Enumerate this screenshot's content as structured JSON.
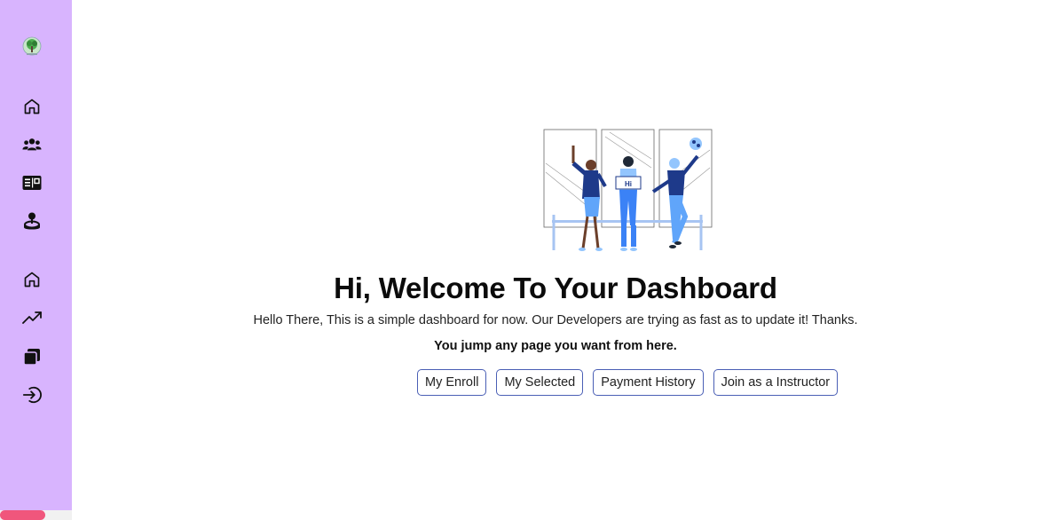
{
  "sidebar": {
    "logo": "tree-logo",
    "nav_top": [
      {
        "icon": "home-icon"
      },
      {
        "icon": "users-icon"
      },
      {
        "icon": "course-book-icon"
      },
      {
        "icon": "joystick-icon"
      }
    ],
    "nav_bottom": [
      {
        "icon": "home-icon"
      },
      {
        "icon": "trending-up-icon"
      },
      {
        "icon": "copy-icon"
      },
      {
        "icon": "sign-in-icon"
      }
    ],
    "scrollbar_color": "#f0567c",
    "background": "#d8b4fe"
  },
  "main": {
    "illustration_badge": "Hi",
    "title": "Hi, Welcome To Your Dashboard",
    "subtitle": "Hello There, This is a simple dashboard for now. Our Developers are trying as fast as to update it! Thanks.",
    "tagline": "You jump any page you want from here.",
    "buttons": {
      "my_enroll": "My Enroll",
      "my_selected": "My Selected",
      "payment_history": "Payment History",
      "join_instructor": "Join as a Instructor"
    },
    "accent": "#4a5fb5"
  }
}
